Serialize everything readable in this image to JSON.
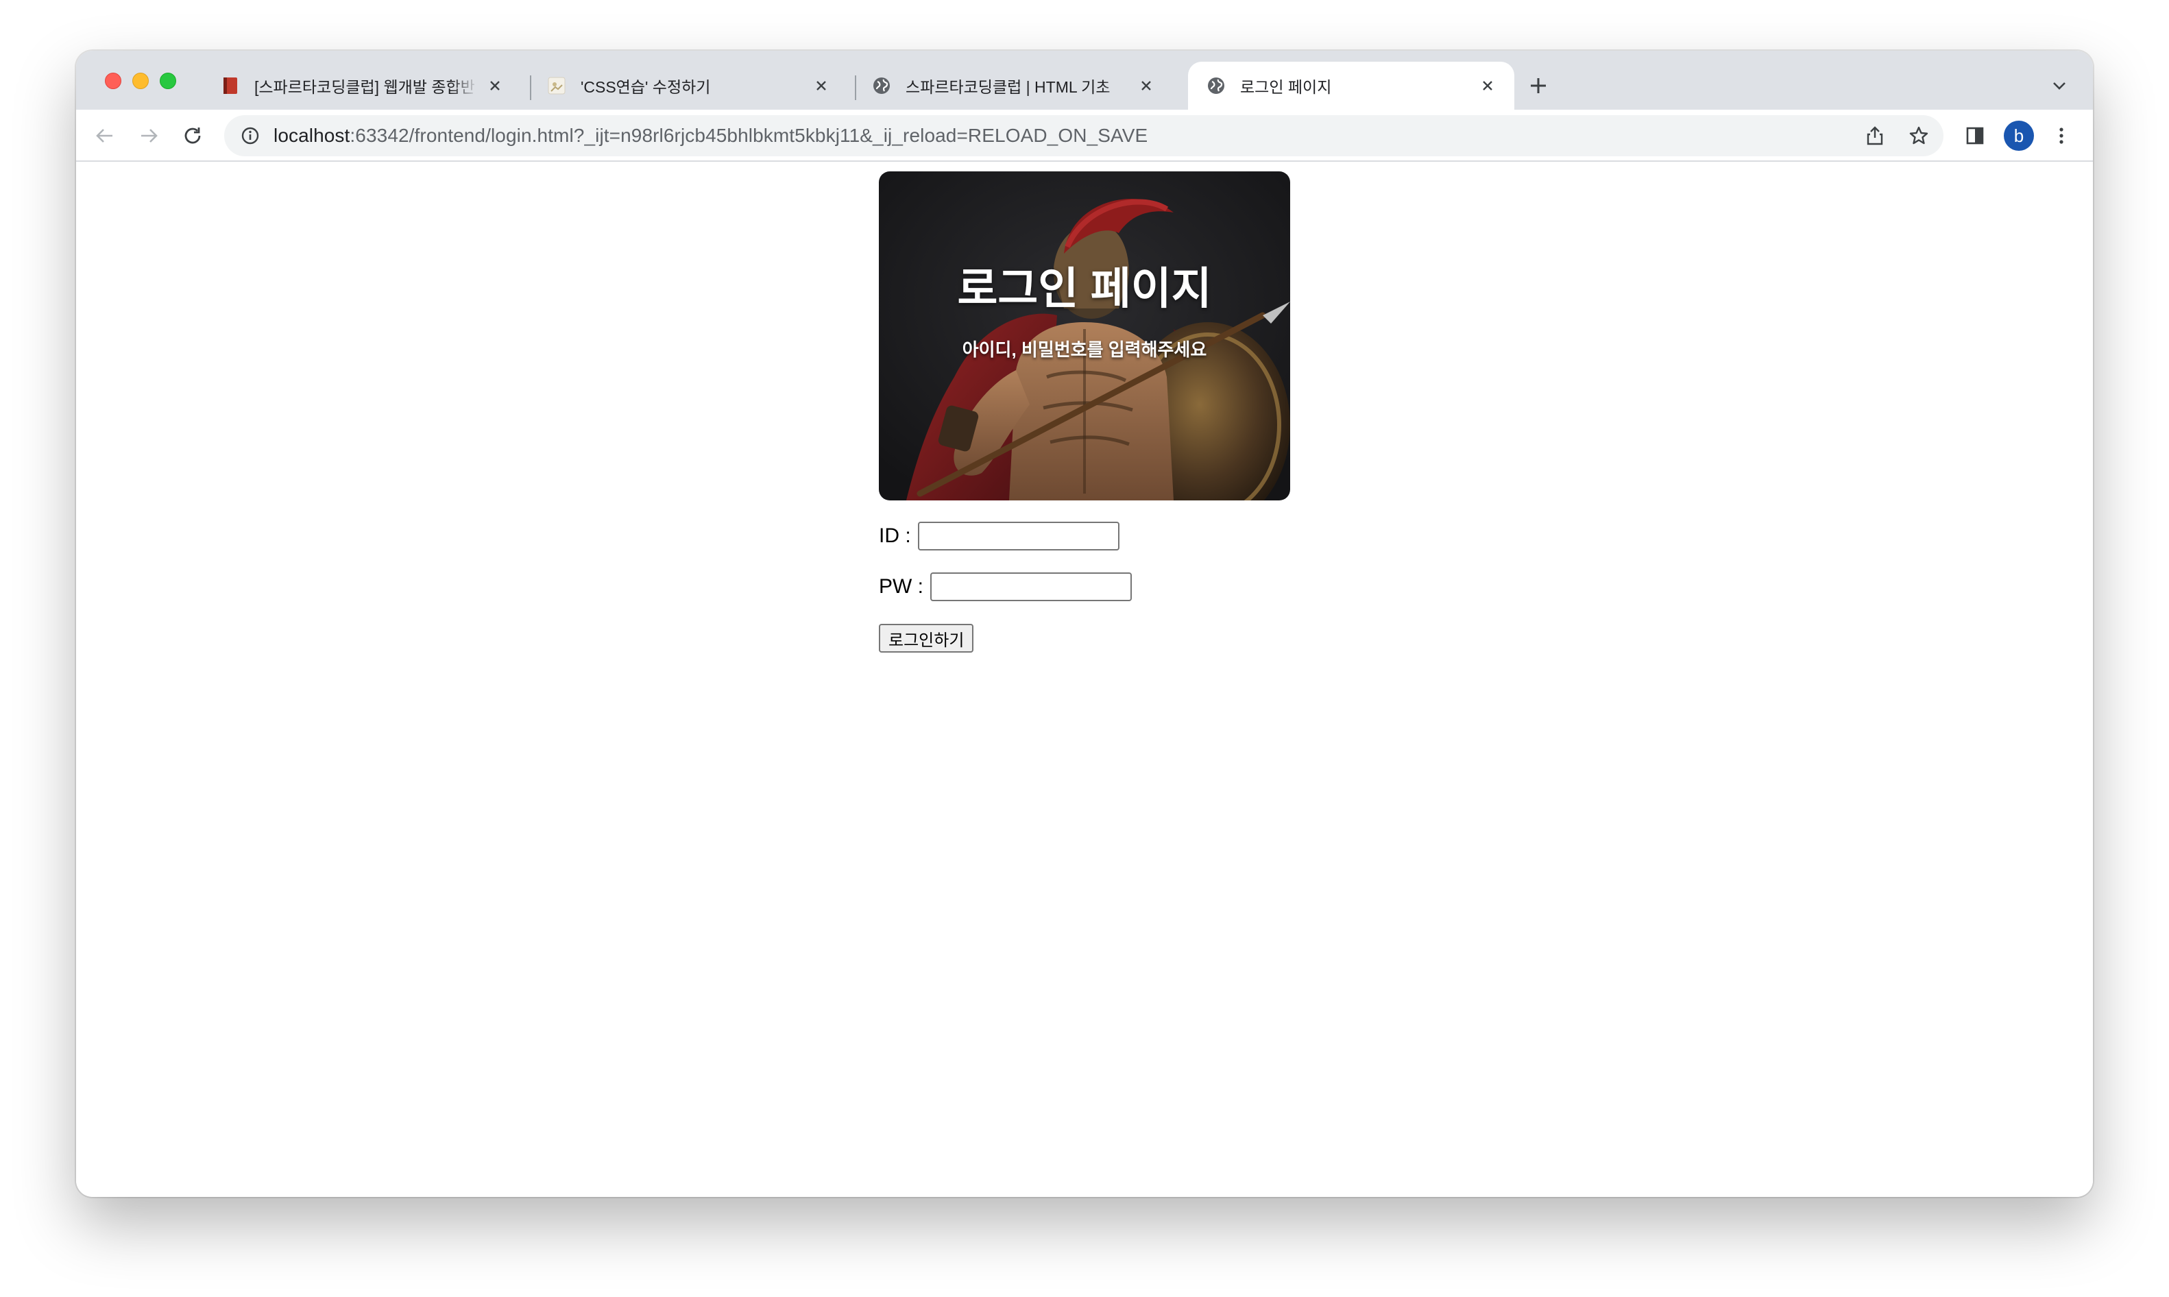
{
  "browser": {
    "tabs": [
      {
        "title": "[스파르타코딩클럽] 웹개발 종합반 -",
        "favicon": "book-icon",
        "active": false
      },
      {
        "title": "'CSS연습' 수정하기",
        "favicon": "page-icon",
        "active": false
      },
      {
        "title": "스파르타코딩클럽 | HTML 기초",
        "favicon": "globe-icon",
        "active": false
      },
      {
        "title": "로그인 페이지",
        "favicon": "globe-icon",
        "active": true
      }
    ],
    "url_host": "localhost",
    "url_rest": ":63342/frontend/login.html?_ijt=n98rl6rjcb45bhlbkmt5kbkj11&_ij_reload=RELOAD_ON_SAVE",
    "profile_initial": "b",
    "colors": {
      "tabstrip": "#dee1e6",
      "omnibox": "#f1f3f4",
      "avatar": "#1a56b0"
    }
  },
  "page": {
    "hero_title": "로그인 페이지",
    "hero_subtitle": "아이디, 비밀번호를 입력해주세요",
    "id_label": "ID :",
    "id_value": "",
    "pw_label": "PW :",
    "pw_value": "",
    "login_button": "로그인하기"
  }
}
